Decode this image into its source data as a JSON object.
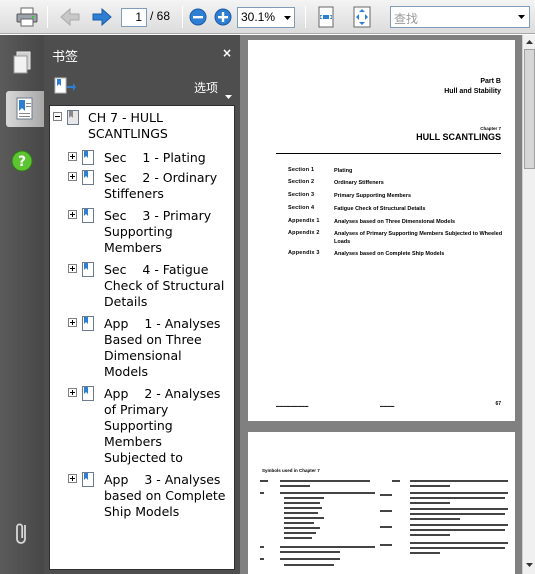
{
  "toolbar": {
    "page_current": "1",
    "page_total": "/ 68",
    "zoom": "30.1%",
    "search_placeholder": "查找"
  },
  "bookmarks_panel": {
    "title": "书签",
    "close": "×",
    "options_label": "选项",
    "items": [
      {
        "lines": [
          "CH 7 - HULL",
          "SCANTLINGS"
        ]
      },
      {
        "lines": [
          "Sec    1 - Plating"
        ]
      },
      {
        "lines": [
          "Sec    2 - Ordinary",
          "Stiffeners"
        ]
      },
      {
        "lines": [
          "Sec    3 - Primary",
          "Supporting",
          "Members"
        ]
      },
      {
        "lines": [
          "Sec    4 - Fatigue",
          "Check of Structural",
          "Details"
        ]
      },
      {
        "lines": [
          "App    1 - Analyses",
          "Based on Three",
          "Dimensional",
          "Models"
        ]
      },
      {
        "lines": [
          "App    2 - Analyses",
          "of Primary",
          "Supporting",
          "Members",
          "Subjected to"
        ]
      },
      {
        "lines": [
          "App    3 - Analyses",
          "based on Complete",
          "Ship Models"
        ]
      }
    ]
  },
  "page1": {
    "part": "Part B",
    "part_title": "Hull and Stability",
    "chapter": "Chapter 7",
    "chapter_title": "HULL SCANTLINGS",
    "toc": [
      {
        "label": "Section 1",
        "title": "Plating"
      },
      {
        "label": "Section 2",
        "title": "Ordinary Stiffeners"
      },
      {
        "label": "Section 3",
        "title": "Primary Supporting Members"
      },
      {
        "label": "Section 4",
        "title": "Fatigue Check of Structural Details"
      },
      {
        "label": "Appendix 1",
        "title": "Analyses based on Three Dimensional Models"
      },
      {
        "label": "Appendix 2",
        "title": "Analyses of Primary Supporting Members Subjected to Wheeled Loads"
      },
      {
        "label": "Appendix 3",
        "title": "Analyses based on Complete Ship Models"
      }
    ],
    "page_number": "67"
  },
  "page2": {
    "heading": "Symbols used in Chapter 7"
  }
}
